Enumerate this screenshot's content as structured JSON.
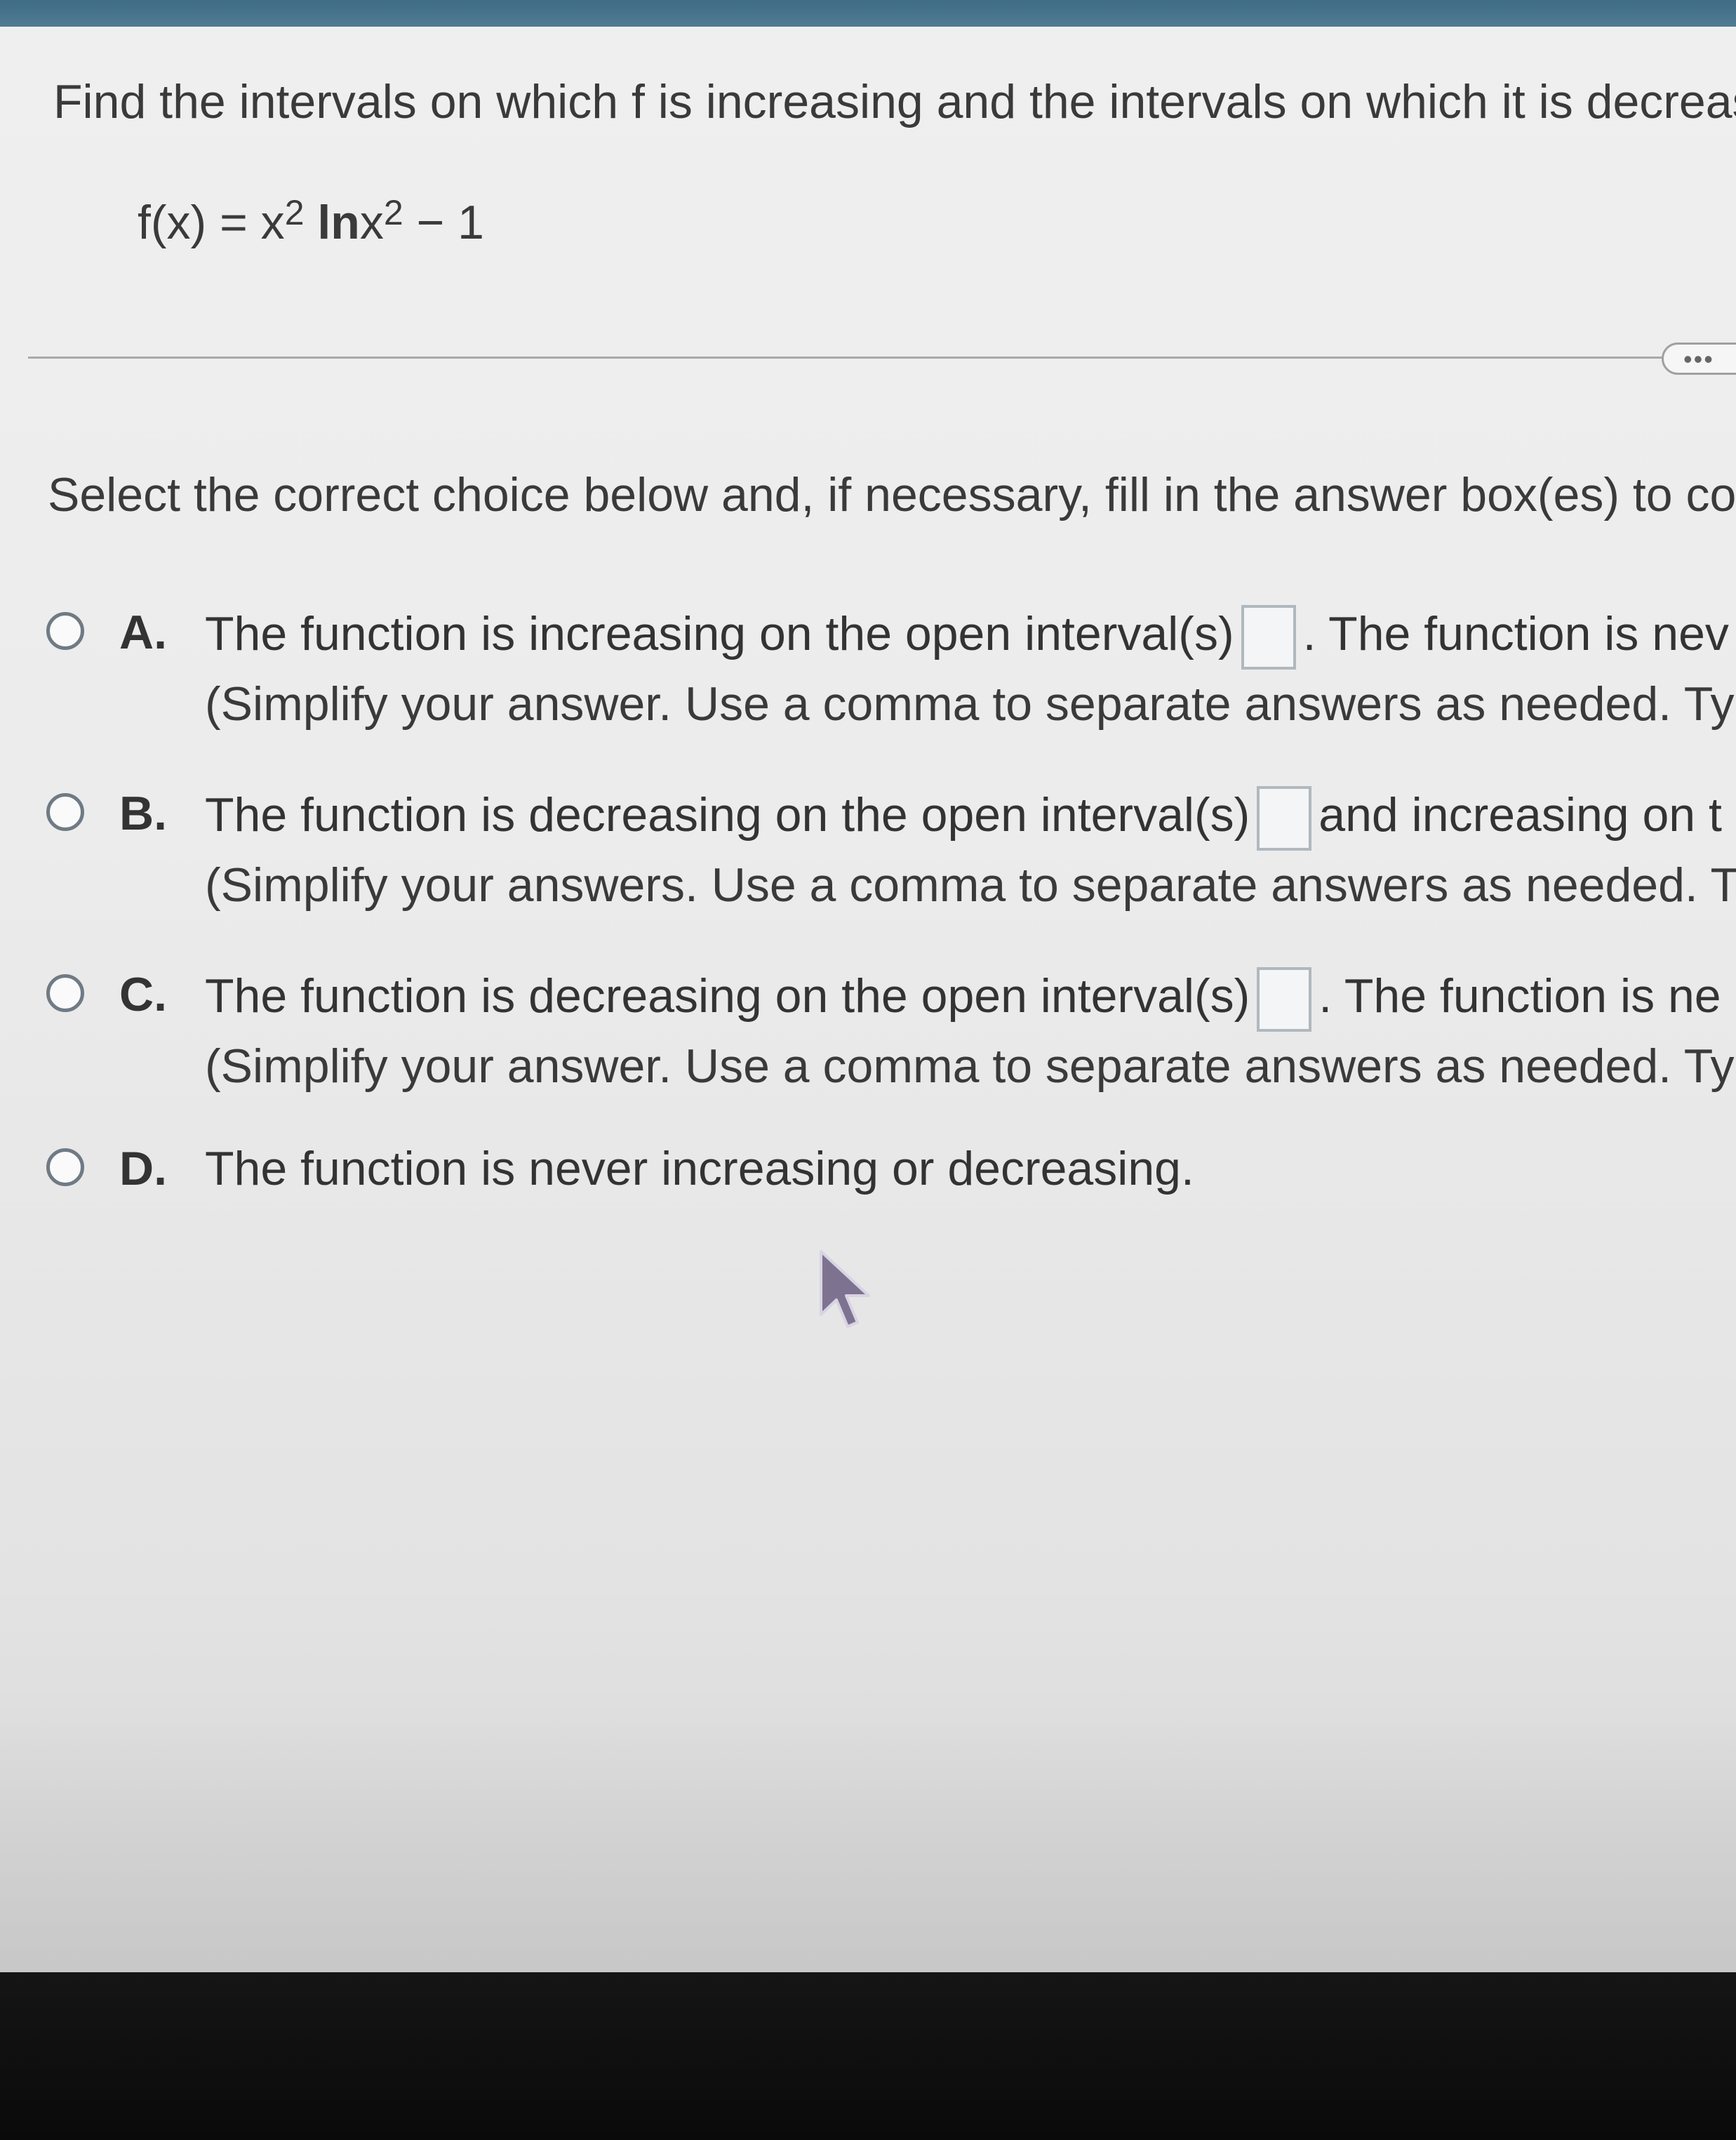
{
  "question": {
    "instruction": "Find the intervals on which f is increasing and the intervals on which it is decreas",
    "formula": {
      "lhs": "f(x) = x",
      "exp1": "2",
      "ln": "ln",
      "x": "x",
      "exp2": "2",
      "tail": " − 1"
    },
    "more_label": "•••"
  },
  "prompt": "Select the correct choice below and, if necessary, fill in the answer box(es) to co",
  "choices": [
    {
      "letter": "A.",
      "text_before": "The function is increasing on the open interval(s)",
      "text_after": ". The function is nev",
      "note": "(Simplify your answer. Use a comma to separate answers as needed. Typ"
    },
    {
      "letter": "B.",
      "text_before": "The function is decreasing on the open interval(s)",
      "text_after": "and increasing on t",
      "note": "(Simplify your answers. Use a comma to separate answers as needed. Ty"
    },
    {
      "letter": "C.",
      "text_before": "The function is decreasing on the open interval(s)",
      "text_after": ". The function is ne",
      "note": "(Simplify your answer. Use a comma to separate answers as needed. Typ"
    },
    {
      "letter": "D.",
      "text_before": "The function is never increasing or decreasing."
    }
  ],
  "colors": {
    "top_bar": "#4a7690",
    "page_background": "#ececec",
    "text": "#333333",
    "radio_border": "#6f7a85",
    "answer_box_border": "#b0b8bf"
  },
  "icons": [
    "radio-icon",
    "cursor-icon",
    "more-options-icon"
  ]
}
